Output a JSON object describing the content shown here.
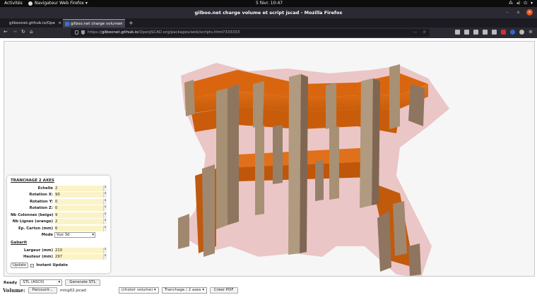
{
  "system": {
    "activities": "Activités",
    "app_menu": "Navigateur Web Firefox ▾",
    "clock": "5 févr. 10:47"
  },
  "window": {
    "title": "gilboo.net charge volume et script jscad - Mozilla Firefox"
  },
  "tabs": [
    {
      "label": "gilboonet.github.io/Ope"
    },
    {
      "label": "gilboo.net charge volume"
    }
  ],
  "url": {
    "prefix": "https://",
    "host": "gilboonet.github.io",
    "path": "/OpenJSCAD.org/packages/web/scripts.html?333333"
  },
  "panel": {
    "section1": "TRANCHAGE 2 AXES",
    "params": [
      {
        "label": "Echelle",
        "value": "2"
      },
      {
        "label": "Rotation X:",
        "value": "90"
      },
      {
        "label": "Rotation Y:",
        "value": "0"
      },
      {
        "label": "Rotation Z:",
        "value": "0"
      },
      {
        "label": "Nb Colonnes (beige)",
        "value": "9"
      },
      {
        "label": "Nb Lignes (orange)",
        "value": "2"
      },
      {
        "label": "Ep. Carton (mm)",
        "value": "6"
      }
    ],
    "mode_label": "Mode",
    "mode_value": "Vue 3d",
    "section2": "Gabarit",
    "gabarit": [
      {
        "label": "Largeur (mm)",
        "value": "210"
      },
      {
        "label": "Hauteur (mm)",
        "value": "297"
      }
    ],
    "update_label": "Update",
    "instant_label": "Instant Update"
  },
  "status": {
    "ready": "Ready",
    "format": "STL (ASCII)",
    "generate": "Generate STL"
  },
  "volume": {
    "label": "Volume:",
    "browse": "Parcourir...",
    "filename": "ming02.jscad",
    "choose": "(choisir volume)",
    "mode": "Tranchage / 2 axes",
    "create": "Créer PDF"
  }
}
